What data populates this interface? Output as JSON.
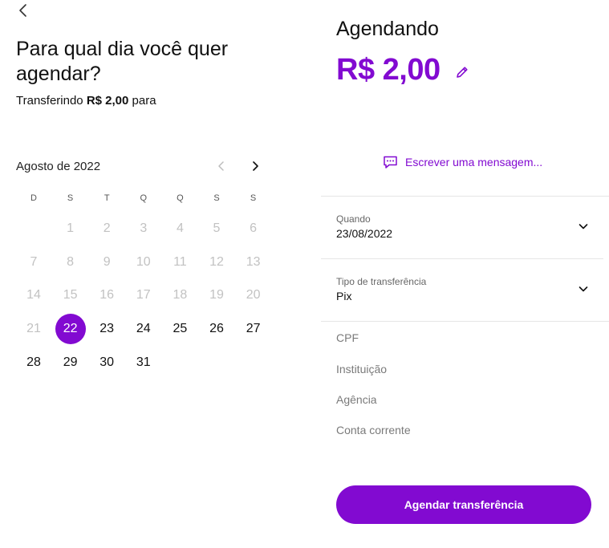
{
  "header": {
    "back_icon": "chevron-left-icon"
  },
  "left": {
    "title": "Para qual dia você quer agendar?",
    "subtitle_prefix": "Transferindo",
    "subtitle_amount": "R$ 2,00",
    "subtitle_suffix": "para"
  },
  "calendar": {
    "month_label": "Agosto de 2022",
    "weekdays": [
      "D",
      "S",
      "T",
      "Q",
      "Q",
      "S",
      "S"
    ],
    "weeks": [
      [
        "",
        "1",
        "2",
        "3",
        "4",
        "5",
        "6"
      ],
      [
        "7",
        "8",
        "9",
        "10",
        "11",
        "12",
        "13"
      ],
      [
        "14",
        "15",
        "16",
        "17",
        "18",
        "19",
        "20"
      ],
      [
        "21",
        "22",
        "23",
        "24",
        "25",
        "26",
        "27"
      ],
      [
        "28",
        "29",
        "30",
        "31",
        "",
        "",
        ""
      ]
    ],
    "selected_day": "22",
    "first_enabled_day": 22,
    "accent": "#820ad1"
  },
  "right": {
    "title": "Agendando",
    "amount": "R$ 2,00",
    "message_label": "Escrever uma mensagem...",
    "when": {
      "label": "Quando",
      "value": "23/08/2022"
    },
    "transfer_type": {
      "label": "Tipo de transferência",
      "value": "Pix"
    },
    "fields": [
      "CPF",
      "Instituição",
      "Agência",
      "Conta corrente"
    ],
    "cta_label": "Agendar transferência"
  }
}
